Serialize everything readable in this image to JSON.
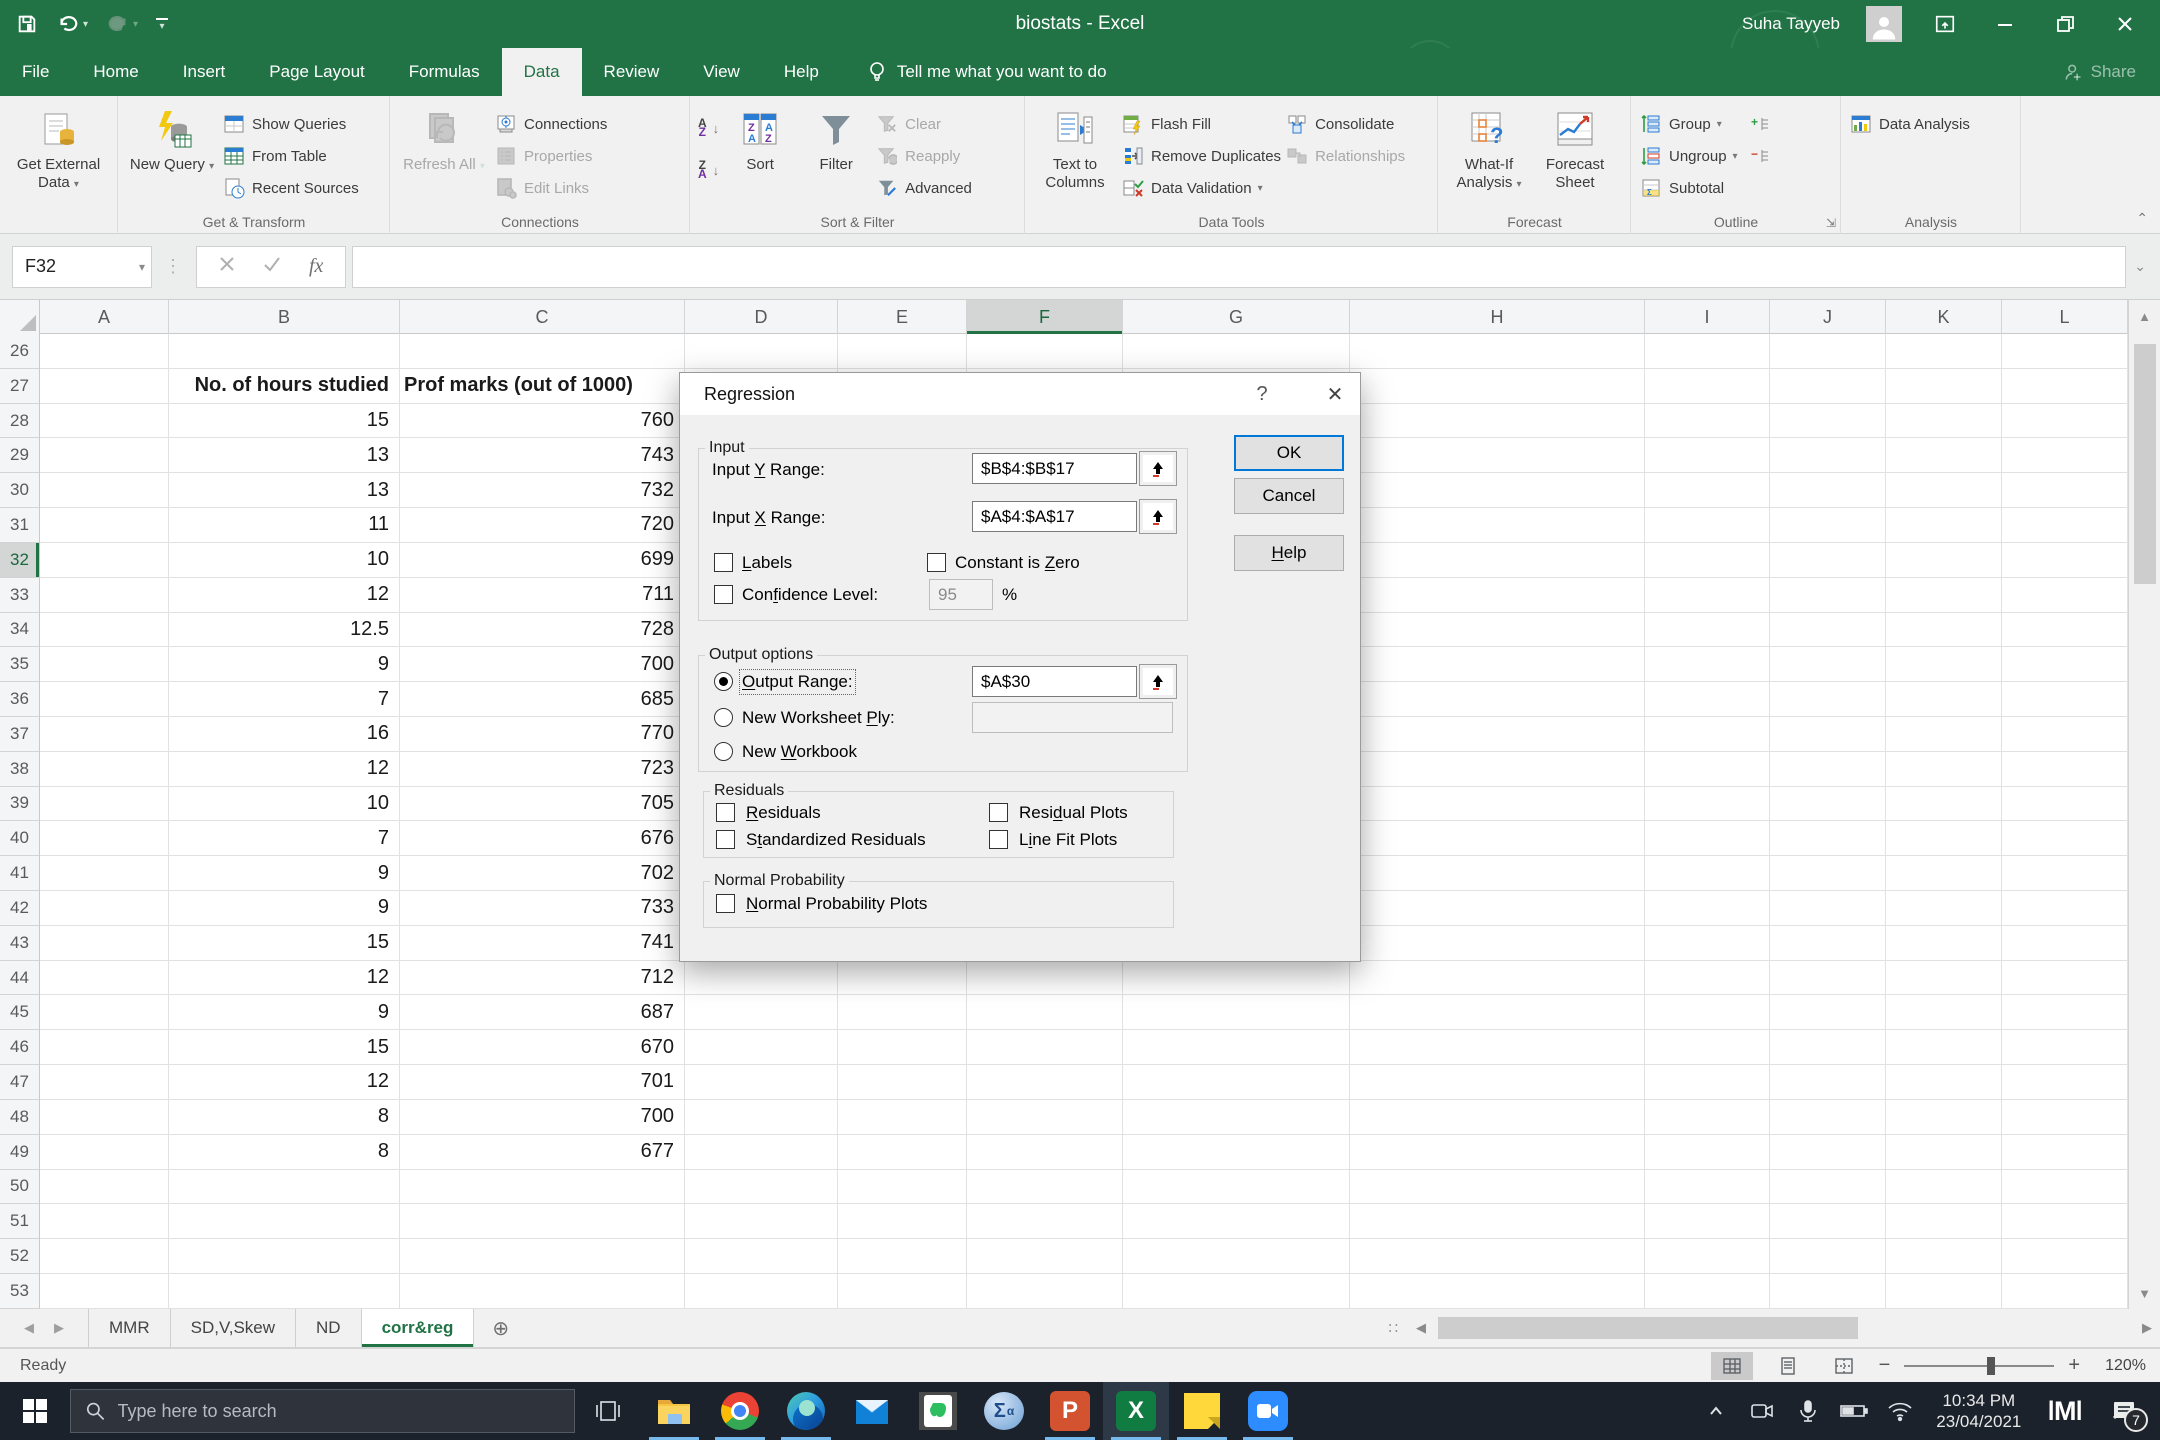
{
  "titlebar": {
    "title": "biostats - Excel",
    "user": "Suha Tayyeb"
  },
  "menu": {
    "tabs": [
      {
        "label": "File"
      },
      {
        "label": "Home"
      },
      {
        "label": "Insert"
      },
      {
        "label": "Page Layout"
      },
      {
        "label": "Formulas"
      },
      {
        "label": "Data",
        "active": true
      },
      {
        "label": "Review"
      },
      {
        "label": "View"
      },
      {
        "label": "Help"
      }
    ],
    "tellme": "Tell me what you want to do",
    "share": "Share"
  },
  "ribbon": {
    "get_external_data": "Get External Data",
    "new_query": "New Query",
    "show_queries": "Show Queries",
    "from_table": "From Table",
    "recent_sources": "Recent Sources",
    "refresh_all": "Refresh All",
    "connections": "Connections",
    "properties": "Properties",
    "edit_links": "Edit Links",
    "sort": "Sort",
    "filter": "Filter",
    "clear": "Clear",
    "reapply": "Reapply",
    "advanced": "Advanced",
    "text_to_columns": "Text to Columns",
    "flash_fill": "Flash Fill",
    "remove_duplicates": "Remove Duplicates",
    "data_validation": "Data Validation",
    "consolidate": "Consolidate",
    "relationships": "Relationships",
    "what_if": "What-If Analysis",
    "forecast_sheet": "Forecast Sheet",
    "group": "Group",
    "ungroup": "Ungroup",
    "subtotal": "Subtotal",
    "data_analysis": "Data Analysis",
    "labels": {
      "get_transform": "Get & Transform",
      "connections": "Connections",
      "sort_filter": "Sort & Filter",
      "data_tools": "Data Tools",
      "forecast": "Forecast",
      "outline": "Outline",
      "analysis": "Analysis"
    }
  },
  "formula_bar": {
    "name_box": "F32",
    "formula": ""
  },
  "sheet": {
    "columns": [
      "A",
      "B",
      "C",
      "D",
      "E",
      "F",
      "G",
      "H",
      "I",
      "J",
      "K",
      "L"
    ],
    "selected_column": "F",
    "selected_row": 32,
    "header_row": 27,
    "rows": [
      {
        "n": 26,
        "hours": "",
        "marks": ""
      },
      {
        "n": 27,
        "hours": "No. of hours studied",
        "marks": "Prof marks (out of 1000)",
        "header": true
      },
      {
        "n": 28,
        "hours": "15",
        "marks": "760"
      },
      {
        "n": 29,
        "hours": "13",
        "marks": "743"
      },
      {
        "n": 30,
        "hours": "13",
        "marks": "732"
      },
      {
        "n": 31,
        "hours": "11",
        "marks": "720"
      },
      {
        "n": 32,
        "hours": "10",
        "marks": "699"
      },
      {
        "n": 33,
        "hours": "12",
        "marks": "711"
      },
      {
        "n": 34,
        "hours": "12.5",
        "marks": "728"
      },
      {
        "n": 35,
        "hours": "9",
        "marks": "700"
      },
      {
        "n": 36,
        "hours": "7",
        "marks": "685"
      },
      {
        "n": 37,
        "hours": "16",
        "marks": "770"
      },
      {
        "n": 38,
        "hours": "12",
        "marks": "723"
      },
      {
        "n": 39,
        "hours": "10",
        "marks": "705"
      },
      {
        "n": 40,
        "hours": "7",
        "marks": "676"
      },
      {
        "n": 41,
        "hours": "9",
        "marks": "702"
      },
      {
        "n": 42,
        "hours": "9",
        "marks": "733"
      },
      {
        "n": 43,
        "hours": "15",
        "marks": "741"
      },
      {
        "n": 44,
        "hours": "12",
        "marks": "712"
      },
      {
        "n": 45,
        "hours": "9",
        "marks": "687"
      },
      {
        "n": 46,
        "hours": "15",
        "marks": "670"
      },
      {
        "n": 47,
        "hours": "12",
        "marks": "701"
      },
      {
        "n": 48,
        "hours": "8",
        "marks": "700"
      },
      {
        "n": 49,
        "hours": "8",
        "marks": "677"
      },
      {
        "n": 50,
        "hours": "",
        "marks": ""
      },
      {
        "n": 51,
        "hours": "",
        "marks": ""
      },
      {
        "n": 52,
        "hours": "",
        "marks": ""
      },
      {
        "n": 53,
        "hours": "",
        "marks": ""
      }
    ]
  },
  "dialog": {
    "title": "Regression",
    "input": {
      "legend": "Input",
      "y_label": {
        "text": "Input Y Range:",
        "u": 6
      },
      "y_value": "$B$4:$B$17",
      "x_label": {
        "text": "Input X Range:",
        "u": 6
      },
      "x_value": "$A$4:$A$17",
      "labels": {
        "text": "Labels",
        "u": 0
      },
      "constant_zero": {
        "text": "Constant is Zero",
        "u": 12
      },
      "confidence": {
        "text": "Confidence Level:",
        "u": 3
      },
      "confidence_value": "95",
      "percent": "%"
    },
    "buttons": {
      "ok": "OK",
      "cancel": "Cancel",
      "help": {
        "text": "Help",
        "u": 0
      }
    },
    "output": {
      "legend": "Output options",
      "output_range": {
        "text": "Output Range:",
        "u": 0
      },
      "output_range_value": "$A$30",
      "new_worksheet": {
        "text": "New Worksheet Ply:",
        "u": 14
      },
      "new_worksheet_value": "",
      "new_workbook": {
        "text": "New Workbook",
        "u": 4
      }
    },
    "residuals": {
      "legend": "Residuals",
      "residuals": {
        "text": "Residuals",
        "u": 0
      },
      "residual_plots": {
        "text": "Residual Plots",
        "u": 4
      },
      "standardized": {
        "text": "Standardized Residuals",
        "u": 1
      },
      "line_fit": {
        "text": "Line Fit Plots",
        "u": 1
      }
    },
    "normal": {
      "legend": "Normal Probability",
      "plots": {
        "text": "Normal Probability Plots",
        "u": 0
      }
    }
  },
  "sheet_tabs": [
    {
      "label": "MMR"
    },
    {
      "label": "SD,V,Skew"
    },
    {
      "label": "ND"
    },
    {
      "label": "corr&reg",
      "active": true
    }
  ],
  "status_bar": {
    "status": "Ready",
    "zoom": "120%"
  },
  "taskbar": {
    "search_placeholder": "Type here to search",
    "icons": [
      "start",
      "search",
      "task-view",
      "file-explorer",
      "chrome",
      "edge",
      "mail",
      "evernote",
      "math-tool",
      "powerpoint",
      "excel",
      "sticky-notes",
      "zoom-app"
    ],
    "tray_icons": [
      "hidden-icons",
      "camera",
      "microphone",
      "battery",
      "network"
    ],
    "time": "10:34 PM",
    "date": "23/04/2021",
    "notification_badge": "7"
  }
}
